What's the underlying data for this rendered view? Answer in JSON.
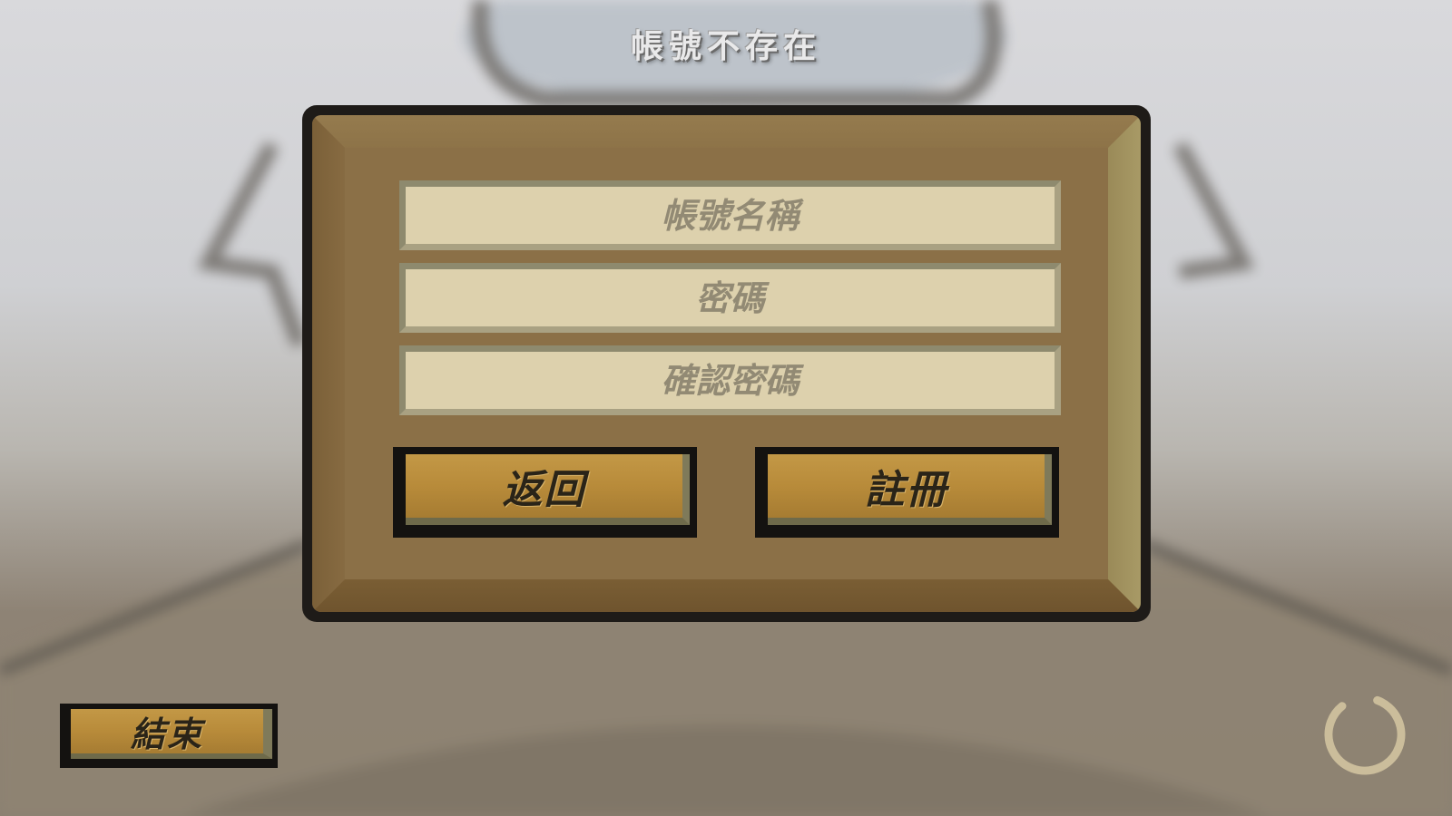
{
  "status_message": "帳號不存在",
  "form": {
    "account_name_placeholder": "帳號名稱",
    "password_placeholder": "密碼",
    "confirm_password_placeholder": "確認密碼",
    "back_label": "返回",
    "register_label": "註冊"
  },
  "footer": {
    "exit_label": "結束"
  },
  "icons": {
    "loading": "loading-spinner-icon"
  },
  "colors": {
    "panel": "#8b7047",
    "field": "#ddd1ad",
    "button": "#b88b3a",
    "frame": "#1e1b18"
  }
}
